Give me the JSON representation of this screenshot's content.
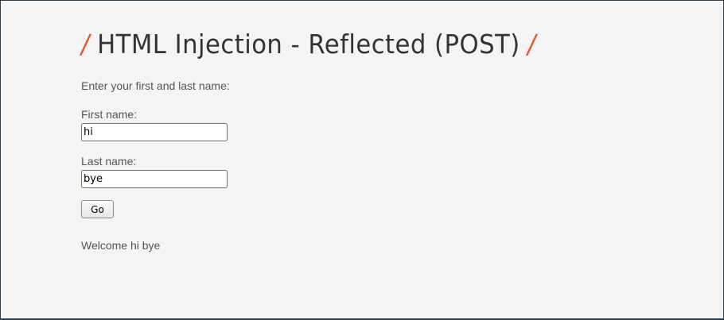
{
  "page": {
    "title": "HTML Injection - Reflected (POST)",
    "title_decoration": "/",
    "intro": "Enter your first and last name:"
  },
  "form": {
    "first_name_label": "First name:",
    "first_name_value": "hi",
    "last_name_label": "Last name:",
    "last_name_value": "bye",
    "submit_label": "Go"
  },
  "result": {
    "welcome_text": "Welcome hi bye"
  },
  "colors": {
    "accent": "#e15a2b",
    "background": "#f4f4f4",
    "text": "#555555"
  }
}
